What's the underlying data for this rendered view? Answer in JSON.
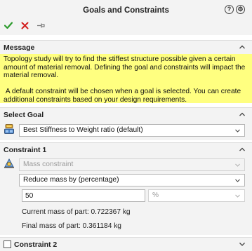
{
  "panel": {
    "title": "Goals and Constraints",
    "header_icons": [
      "help-icon",
      "info-icon"
    ],
    "toolbar": {
      "ok_icon": "checkmark-icon",
      "cancel_icon": "x-icon",
      "pin_icon": "pushpin-icon",
      "ok_color": "#2c9b2c",
      "cancel_color": "#d32020"
    }
  },
  "message": {
    "title": "Message",
    "paragraph1": "Topology study will try to find the stiffest structure possible given a certain amount of material removal. Defining the goal and constraints will impact the material removal.",
    "paragraph2": " A default constraint will be chosen when a goal is selected. You can create additional constraints based on your design requirements.",
    "background": "#ffff80"
  },
  "select_goal": {
    "title": "Select Goal",
    "value": "Best Stiffness to Weight ratio (default)"
  },
  "constraint1": {
    "title": "Constraint 1",
    "type_value": "Mass constraint",
    "mode_value": "Reduce mass by (percentage)",
    "amount_value": "50",
    "unit_value": "%",
    "current_mass": "Current mass of part: 0.722367 kg",
    "final_mass": "Final mass of part: 0.361184 kg"
  },
  "constraint2": {
    "title": "Constraint 2",
    "checked": false
  }
}
